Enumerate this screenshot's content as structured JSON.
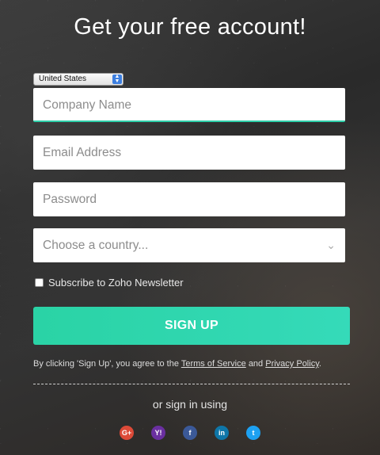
{
  "header": {
    "title": "Get your free account!"
  },
  "country_select": {
    "value": "United States"
  },
  "form": {
    "company_placeholder": "Company Name",
    "email_placeholder": "Email Address",
    "password_placeholder": "Password",
    "country_placeholder": "Choose a country..."
  },
  "newsletter": {
    "label": "Subscribe to Zoho Newsletter",
    "checked": false
  },
  "signup": {
    "label": "SIGN UP"
  },
  "terms": {
    "prefix": "By clicking 'Sign Up', you agree to the",
    "tos": "Terms of Service",
    "and": "and",
    "privacy": "Privacy Policy",
    "suffix": "."
  },
  "social": {
    "label": "or sign in using",
    "providers": [
      {
        "name": "google",
        "icon": "google-plus-icon",
        "glyph": "G+",
        "color": "#dc4a38"
      },
      {
        "name": "yahoo",
        "icon": "yahoo-icon",
        "glyph": "Y!",
        "color": "#6a2fa0"
      },
      {
        "name": "facebook",
        "icon": "facebook-icon",
        "glyph": "f",
        "color": "#3b5998"
      },
      {
        "name": "linkedin",
        "icon": "linkedin-icon",
        "glyph": "in",
        "color": "#0e76a8"
      },
      {
        "name": "twitter",
        "icon": "twitter-icon",
        "glyph": "t",
        "color": "#1da1f2"
      }
    ]
  }
}
